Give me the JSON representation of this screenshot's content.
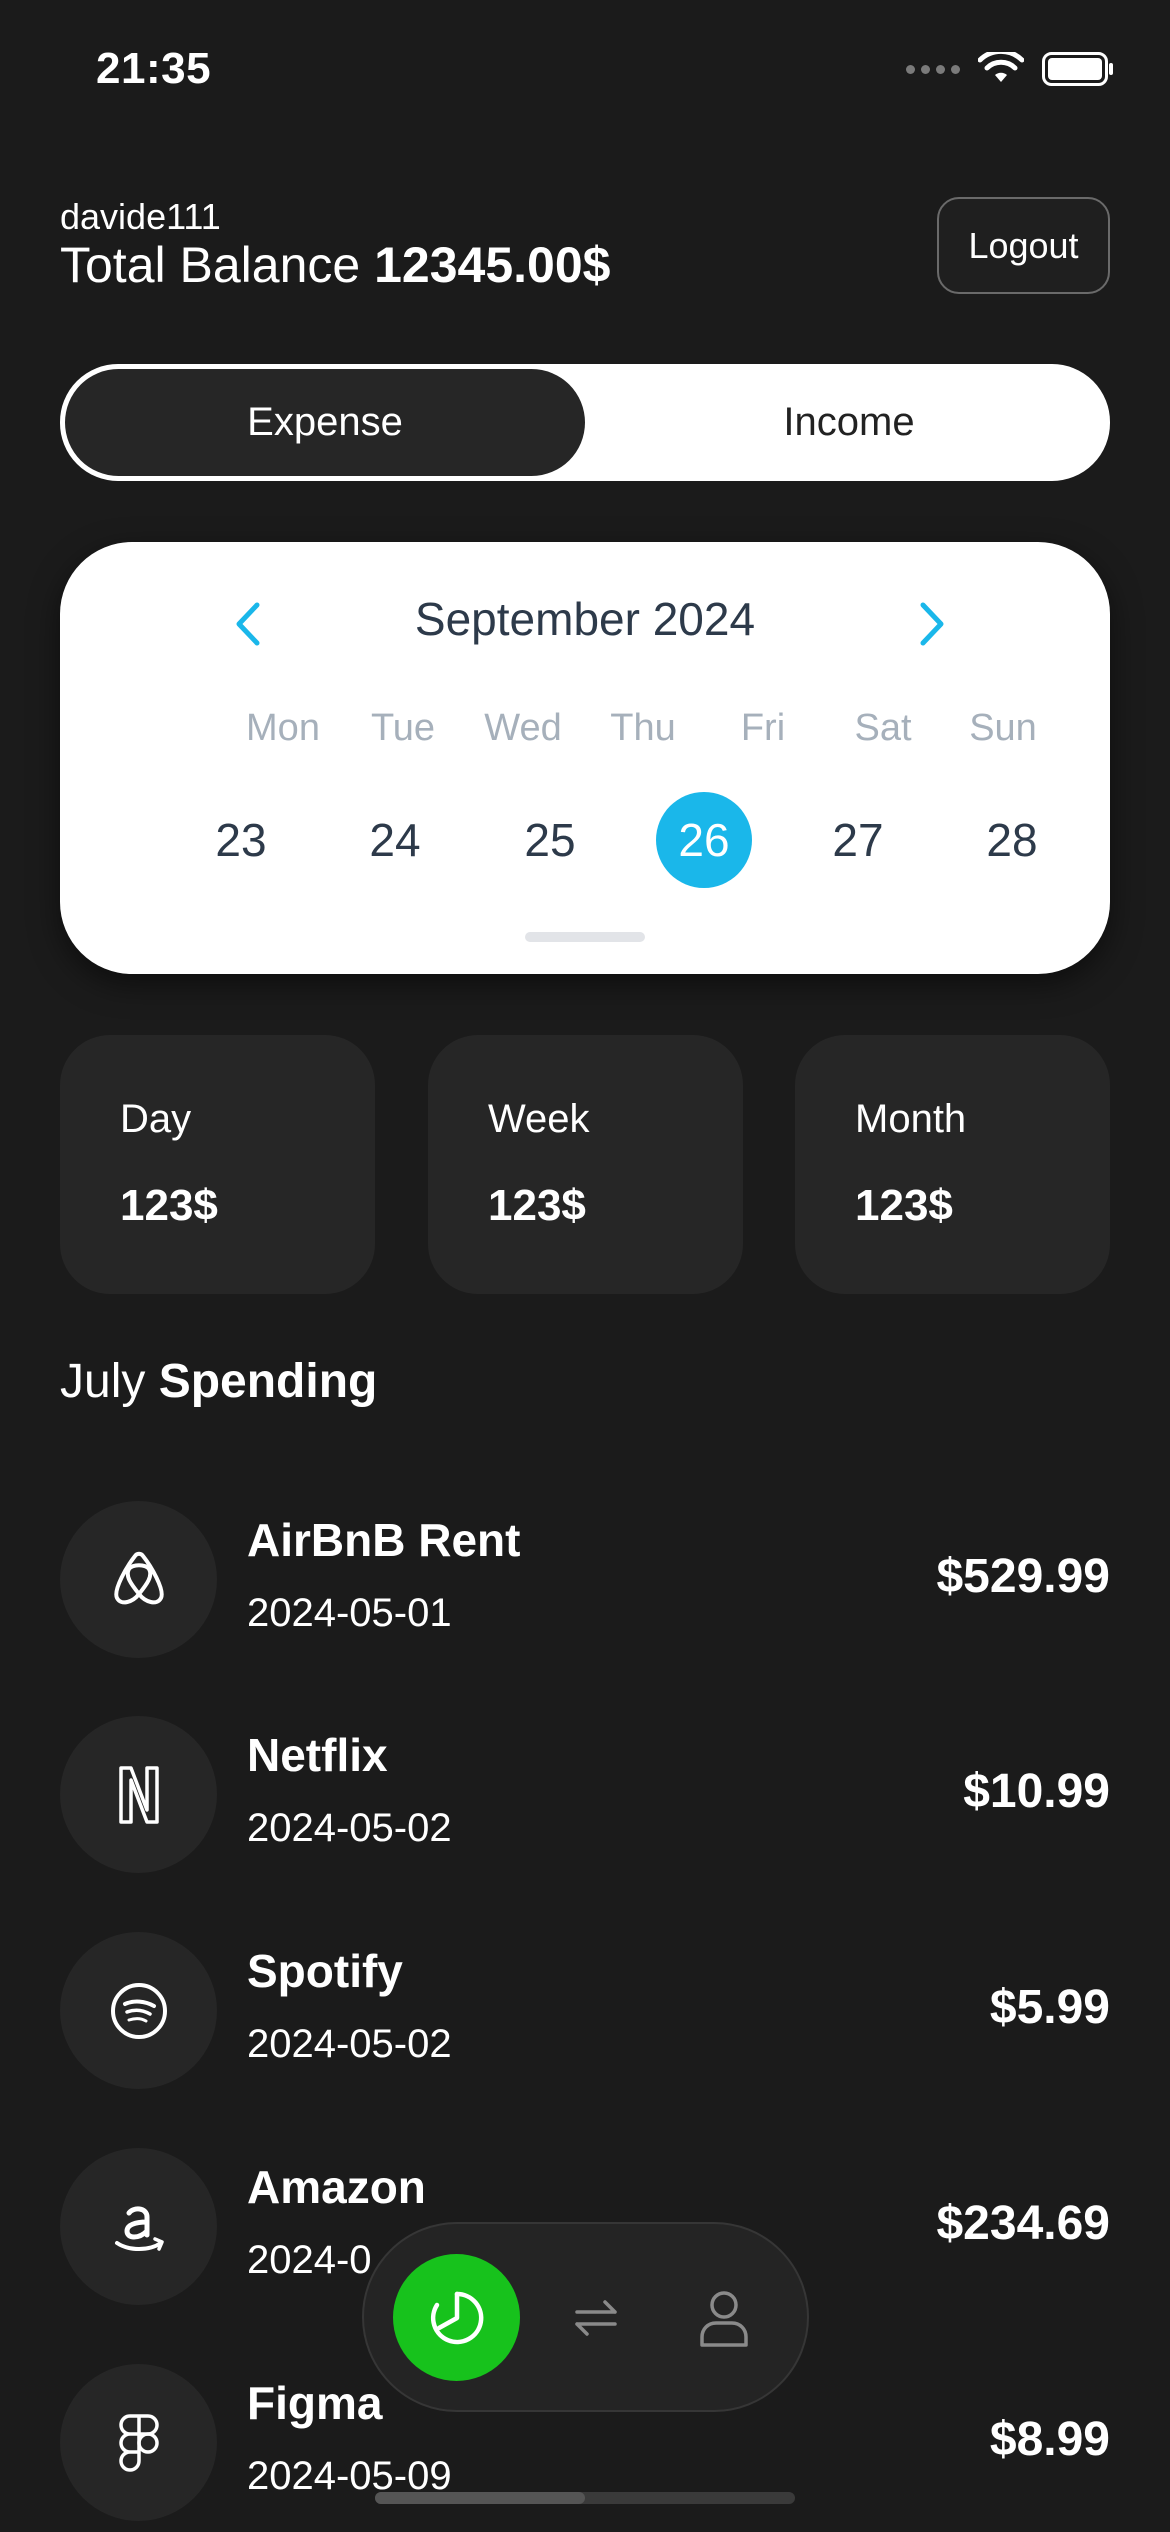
{
  "status_bar": {
    "time": "21:35"
  },
  "header": {
    "username": "davide111",
    "balance_label": "Total Balance",
    "balance_value": "12345.00$",
    "logout_label": "Logout"
  },
  "toggle": {
    "expense_label": "Expense",
    "income_label": "Income",
    "selected": "Expense"
  },
  "calendar": {
    "month_label": "September 2024",
    "weekdays": [
      "Mon",
      "Tue",
      "Wed",
      "Thu",
      "Fri",
      "Sat",
      "Sun"
    ],
    "days": [
      "23",
      "24",
      "25",
      "26",
      "27",
      "28"
    ],
    "selected_day": "26",
    "accent_color": "#1ab7ea"
  },
  "stats": [
    {
      "label": "Day",
      "value": "123$"
    },
    {
      "label": "Week",
      "value": "123$"
    },
    {
      "label": "Month",
      "value": "123$"
    }
  ],
  "spending": {
    "title_prefix": "July",
    "title_bold": "Spending",
    "transactions": [
      {
        "name": "AirBnB Rent",
        "date": "2024-05-01",
        "amount": "$529.99",
        "icon": "airbnb-icon"
      },
      {
        "name": "Netflix",
        "date": "2024-05-02",
        "amount": "$10.99",
        "icon": "netflix-icon"
      },
      {
        "name": "Spotify",
        "date": "2024-05-02",
        "amount": "$5.99",
        "icon": "spotify-icon"
      },
      {
        "name": "Amazon",
        "date": "2024-0",
        "amount": "$234.69",
        "icon": "amazon-icon"
      },
      {
        "name": "Figma",
        "date": "2024-05-09",
        "amount": "$8.99",
        "icon": "figma-icon"
      }
    ]
  },
  "nav": {
    "items": [
      "chart-icon",
      "transfer-icon",
      "profile-icon"
    ],
    "active_color": "#17c21c"
  }
}
